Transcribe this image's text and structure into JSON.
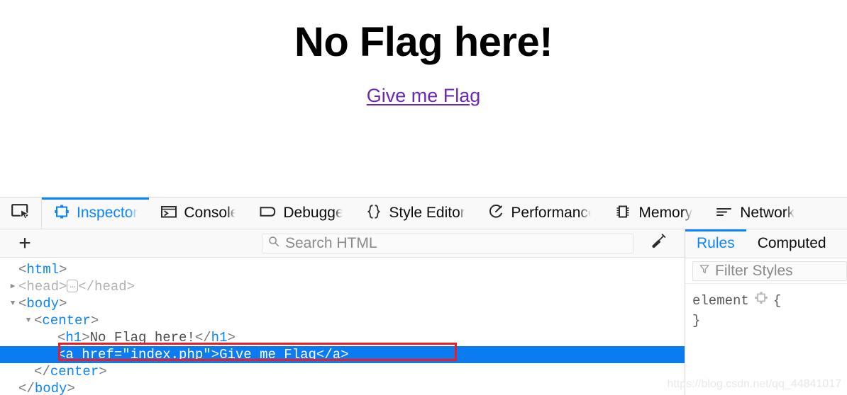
{
  "page": {
    "heading": "No Flag here!",
    "link_text": "Give me Flag",
    "link_color": "#6a29b4"
  },
  "devtools": {
    "picker_icon": "element-picker-icon",
    "main_tabs": [
      {
        "id": "inspector",
        "label": "Inspector",
        "icon": "inspector-icon",
        "active": true
      },
      {
        "id": "console",
        "label": "Console",
        "icon": "console-icon",
        "active": false
      },
      {
        "id": "debugger",
        "label": "Debugger",
        "icon": "debugger-icon",
        "active": false
      },
      {
        "id": "styleeditor",
        "label": "Style Editor",
        "icon": "braces-icon",
        "active": false
      },
      {
        "id": "performance",
        "label": "Performance",
        "icon": "performance-icon",
        "active": false
      },
      {
        "id": "memory",
        "label": "Memory",
        "icon": "memory-icon",
        "active": false
      },
      {
        "id": "network",
        "label": "Network",
        "icon": "network-icon",
        "active": false
      }
    ],
    "markup_toolbar": {
      "add_node_label": "+",
      "add_node_icon": "plus-icon",
      "search_placeholder": "Search HTML",
      "search_value": "",
      "search_icon": "search-icon",
      "eyedropper_icon": "eyedropper-icon"
    },
    "dom_tree": [
      {
        "indent": 0,
        "twisty": "",
        "kind": "open",
        "text": "<html>"
      },
      {
        "indent": 1,
        "twisty": "▶",
        "kind": "collapsed",
        "text": "<head>…</head>"
      },
      {
        "indent": 1,
        "twisty": "▼",
        "kind": "open",
        "text": "<body>"
      },
      {
        "indent": 2,
        "twisty": "▼",
        "kind": "open",
        "text": "<center>"
      },
      {
        "indent": 3,
        "twisty": "",
        "kind": "element",
        "text": "<h1>No Flag here!</h1>"
      },
      {
        "indent": 3,
        "twisty": "",
        "kind": "selected",
        "text": "<a href=\"index.php\">Give me Flag</a>"
      },
      {
        "indent": 2,
        "twisty": "",
        "kind": "close",
        "text": "</center>"
      },
      {
        "indent": 1,
        "twisty": "",
        "kind": "close",
        "text": "</body>"
      }
    ],
    "selected_node": {
      "tag": "a",
      "attr_name": "href",
      "attr_value": "index.php",
      "inner_text": "Give me Flag",
      "highlight_color": "#0a7bf0",
      "annotation_color": "#ed1c24"
    },
    "rules_panel": {
      "tabs": [
        {
          "id": "rules",
          "label": "Rules",
          "active": true
        },
        {
          "id": "computed",
          "label": "Computed",
          "active": false
        }
      ],
      "filter_placeholder": "Filter Styles",
      "filter_value": "",
      "filter_icon": "funnel-icon",
      "rules": [
        {
          "selector": "element",
          "icon": "highlight-node-icon",
          "open_brace": "{"
        },
        {
          "close_brace": "}"
        }
      ]
    },
    "accent_color": "#0a84ff"
  },
  "watermark": "https://blog.csdn.net/qq_44841017"
}
